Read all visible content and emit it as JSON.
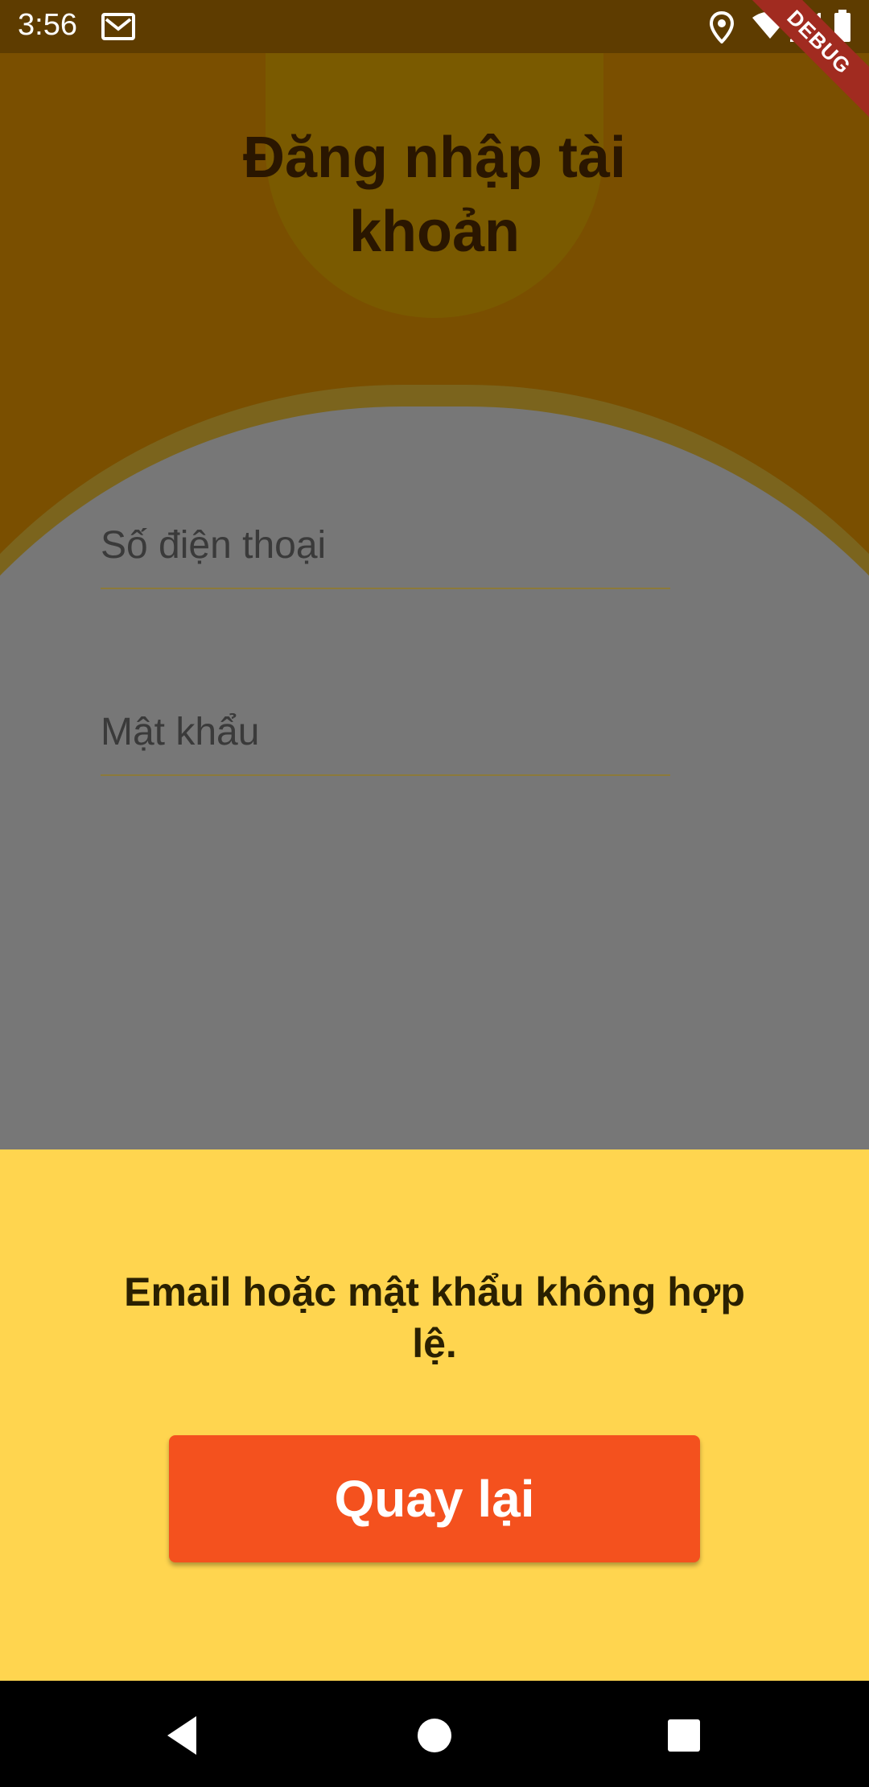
{
  "status_bar": {
    "time": "3:56",
    "icons": [
      "gmail-icon",
      "location-icon",
      "wifi-icon",
      "signal-icon",
      "battery-icon"
    ],
    "debug_label": "DEBUG"
  },
  "header": {
    "title": "Đăng nhập tài\nkhoản"
  },
  "form": {
    "phone_label": "Số điện thoại",
    "password_label": "Mật khẩu"
  },
  "bottom_sheet": {
    "message": "Email hoặc mật khẩu không hợp lệ.",
    "back_button_label": "Quay lại"
  },
  "nav_bar": {
    "buttons": [
      "back-icon",
      "home-icon",
      "recents-icon"
    ]
  },
  "colors": {
    "header_bg": "#7a4f00",
    "card_bg": "#777777",
    "sheet_bg": "#ffd54f",
    "button_bg": "#f4511e",
    "debug_bg": "#a12b20"
  }
}
